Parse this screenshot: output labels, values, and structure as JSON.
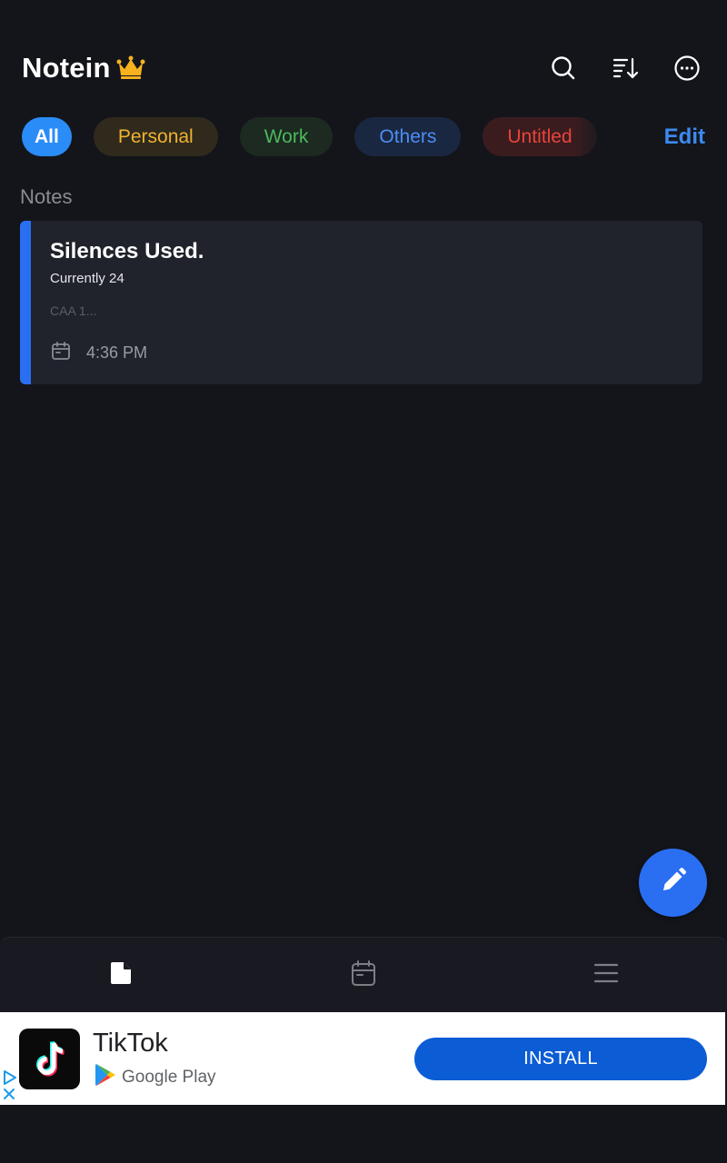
{
  "app": {
    "title": "Notein",
    "icons": [
      "crown-icon",
      "search-icon",
      "sort-icon",
      "more-icon"
    ]
  },
  "categories": {
    "items": [
      {
        "label": "All",
        "color": "#2a8cf7"
      },
      {
        "label": "Personal",
        "color": "#f0b230"
      },
      {
        "label": "Work",
        "color": "#4cb95b"
      },
      {
        "label": "Others",
        "color": "#4d8df5"
      },
      {
        "label": "Untitled",
        "color": "#e8443a"
      }
    ],
    "edit_label": "Edit",
    "selected": "All"
  },
  "notes": {
    "section_title": "Notes",
    "items": [
      {
        "title": "Silences Used.",
        "subtitle": "Currently 24",
        "preview": "CAA 1...",
        "time": "4:36 PM",
        "accent_color": "#2a6ff2"
      }
    ]
  },
  "fab": {
    "icon": "pencil-icon"
  },
  "bottom_nav": {
    "items": [
      {
        "icon": "document-icon",
        "active": true
      },
      {
        "icon": "calendar-icon",
        "active": false
      },
      {
        "icon": "menu-icon",
        "active": false
      }
    ]
  },
  "ad": {
    "app_name": "TikTok",
    "store_name": "Google Play",
    "install_label": "INSTALL",
    "icons": [
      "tiktok-logo-icon",
      "google-play-icon",
      "adchoices-icon",
      "close-icon"
    ]
  }
}
